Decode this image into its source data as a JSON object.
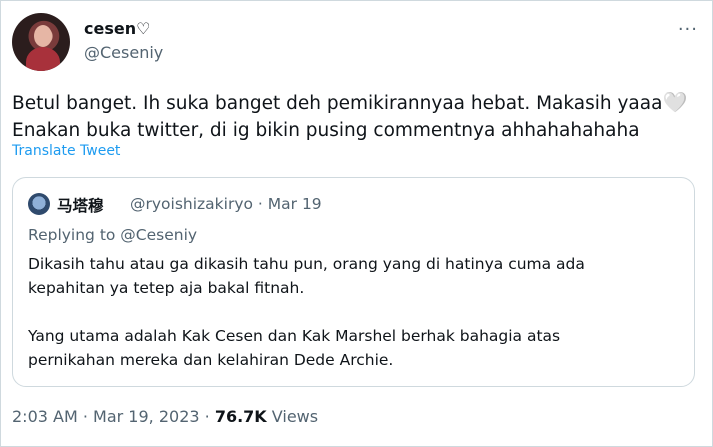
{
  "author": {
    "name": "cesen♡",
    "handle": "@Ceseniy"
  },
  "more_label": "···",
  "tweet": {
    "line1": "Betul banget. Ih suka banget deh pemikirannyaa hebat. Makasih yaaa",
    "heart": "🤍",
    "line2": "Enakan buka twitter, di ig bikin pusing commentnya ahhahahahaha",
    "translate_label": "Translate Tweet"
  },
  "quote": {
    "name": "马塔穆",
    "handle_date": "@ryoishizakiryo · Mar 19",
    "replying": "Replying to @Ceseniy",
    "text": "Dikasih tahu atau ga dikasih tahu pun, orang yang di hatinya cuma ada\nkepahitan ya tetep aja bakal fitnah.\n\nYang utama adalah Kak Cesen dan Kak Marshel berhak bahagia atas\npernikahan mereka dan kelahiran Dede Archie."
  },
  "meta": {
    "time_date": "2:03 AM · Mar 19, 2023 · ",
    "views_count": "76.7K",
    "views_label": " Views"
  }
}
